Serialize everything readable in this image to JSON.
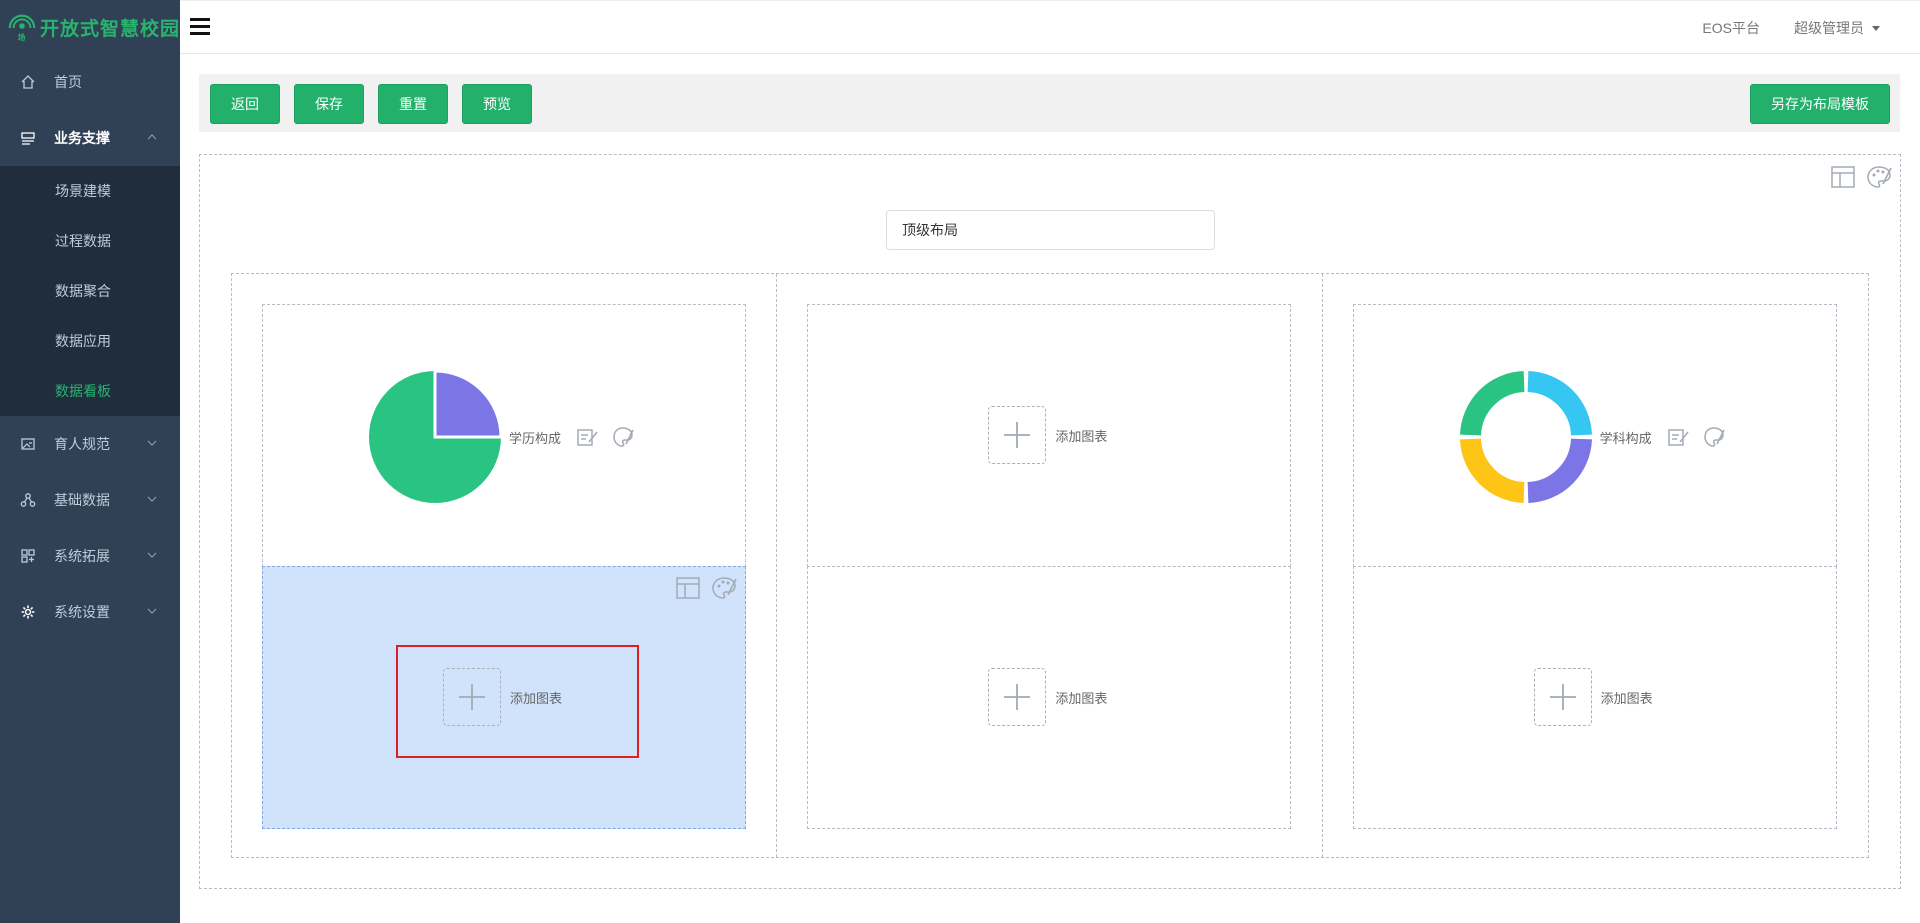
{
  "app": {
    "title": "开放式智慧校园"
  },
  "sidebar": {
    "items": [
      {
        "label": "首页",
        "icon": "home-icon"
      },
      {
        "label": "业务支撑",
        "icon": "dashboard-icon",
        "expanded": true,
        "children": [
          {
            "label": "场景建模"
          },
          {
            "label": "过程数据"
          },
          {
            "label": "数据聚合"
          },
          {
            "label": "数据应用"
          },
          {
            "label": "数据看板",
            "active": true
          }
        ]
      },
      {
        "label": "育人规范",
        "icon": "image-icon"
      },
      {
        "label": "基础数据",
        "icon": "cluster-icon"
      },
      {
        "label": "系统拓展",
        "icon": "apps-icon"
      },
      {
        "label": "系统设置",
        "icon": "settings-icon"
      }
    ]
  },
  "header": {
    "platform": "EOS平台",
    "user": "超级管理员"
  },
  "toolbar": {
    "back": "返回",
    "save": "保存",
    "reset": "重置",
    "preview": "预览",
    "save_as_template": "另存为布局模板"
  },
  "layout": {
    "title_value": "顶级布局",
    "columns": [
      {
        "cells": [
          {
            "type": "chart",
            "chart_kind": "pie",
            "label": "学历构成"
          },
          {
            "type": "add",
            "label": "添加图表",
            "selected": true
          }
        ]
      },
      {
        "cells": [
          {
            "type": "add",
            "label": "添加图表"
          },
          {
            "type": "add",
            "label": "添加图表"
          }
        ]
      },
      {
        "cells": [
          {
            "type": "chart",
            "chart_kind": "donut",
            "label": "学科构成"
          },
          {
            "type": "add",
            "label": "添加图表"
          }
        ]
      }
    ]
  },
  "colors": {
    "sidebar_bg": "#304156",
    "submenu_bg": "#1f2d3d",
    "accent_green": "#22b06b",
    "selected_cell_bg": "#d1e3fa",
    "pie_green": "#2ac482",
    "pie_purple": "#7b75e6",
    "donut_blue": "#36c6f2",
    "donut_yellow": "#ffc516"
  }
}
